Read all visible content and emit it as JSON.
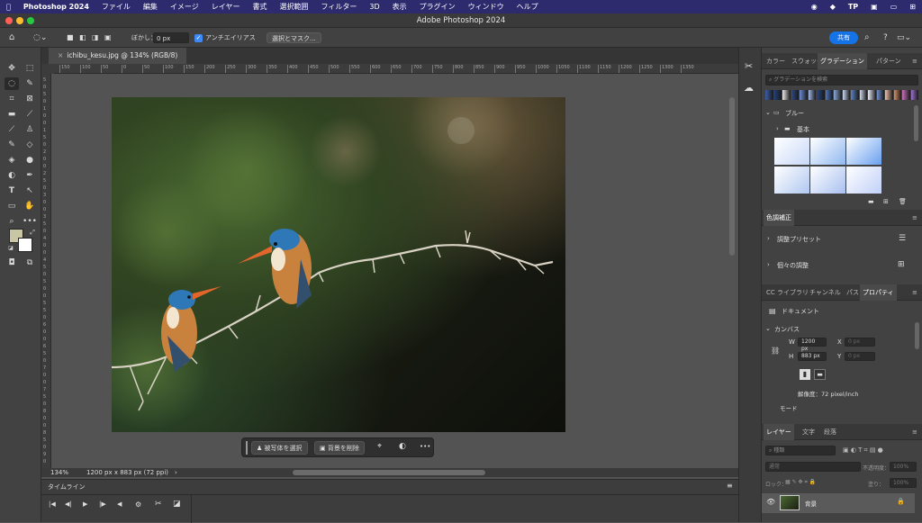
{
  "menubar": {
    "app": "Photoshop 2024",
    "items": [
      "ファイル",
      "編集",
      "イメージ",
      "レイヤー",
      "書式",
      "選択範囲",
      "フィルター",
      "3D",
      "表示",
      "プラグイン",
      "ウィンドウ",
      "ヘルプ"
    ],
    "tp": "TP"
  },
  "titlebar": {
    "title": "Adobe Photoshop 2024"
  },
  "options": {
    "feather_label": "ぼかし：",
    "feather_value": "0 px",
    "antialias_label": "アンチエイリアス",
    "select_mask": "選択とマスク...",
    "share": "共有"
  },
  "doc": {
    "tab_title": "ichibu_kesu.jpg @ 134% (RGB/8)"
  },
  "ruler": {
    "h_ticks": [
      "150",
      "100",
      "50",
      "0",
      "50",
      "100",
      "150",
      "200",
      "250",
      "300",
      "350",
      "400",
      "450",
      "500",
      "550",
      "600",
      "650",
      "700",
      "750",
      "800",
      "850",
      "900",
      "950",
      "1000",
      "1050",
      "1100",
      "1150",
      "1200",
      "1250",
      "1300",
      "1350"
    ],
    "v_ticks": [
      "5",
      "0",
      "5",
      "0",
      "1",
      "0",
      "0",
      "1",
      "5",
      "0",
      "2",
      "0",
      "0",
      "2",
      "5",
      "0",
      "3",
      "0",
      "0",
      "3",
      "5",
      "0",
      "4",
      "0",
      "0",
      "4",
      "5",
      "0",
      "5",
      "0",
      "0",
      "5",
      "5",
      "0",
      "6",
      "0",
      "0",
      "6",
      "5",
      "0",
      "7",
      "0",
      "0",
      "7",
      "5",
      "0",
      "8",
      "0",
      "0",
      "8",
      "5",
      "0",
      "9",
      "0"
    ]
  },
  "context_bar": {
    "select_subject": "被写体を選択",
    "remove_bg": "背景を削除",
    "more": "•••"
  },
  "status": {
    "zoom": "134%",
    "dims": "1200 px x 883 px (72 ppi)",
    "arrow": "›"
  },
  "timeline": {
    "title": "タイムライン"
  },
  "gradients": {
    "tabs": [
      "カラー",
      "スウォッチ",
      "グラデーション",
      "パターン"
    ],
    "search_placeholder": "グラデーションを検索",
    "folder_blue": "ブルー",
    "folder_basic": "基本",
    "swatch_colors": [
      "#3b5ea8",
      "#1f3f78",
      "#e8e8e8",
      "#2c4a8a",
      "#6a8ad0",
      "#a0b8e8",
      "#284680",
      "#4a78c8",
      "#8aa8d8",
      "#c8d8f0",
      "#5c84c4",
      "#d0d8ee",
      "#e8ecf8",
      "#7090d0",
      "#f0c0a8",
      "#d89060",
      "#c870b8",
      "#9a70d0"
    ],
    "grid_colors": [
      "#c8d8f8",
      "#90b8f0",
      "#6aa0f0",
      "#b0c8f0",
      "#a8c0f0",
      "#c0d0f8"
    ]
  },
  "adjust": {
    "tab": "色調補正",
    "preset": "調整プリセット",
    "individual": "個々の調整"
  },
  "props": {
    "tabs": [
      "CC ライブラリ",
      "チャンネル",
      "パス",
      "プロパティ"
    ],
    "doc_label": "ドキュメント",
    "canvas": "カンバス",
    "w_label": "W",
    "w_value": "1200 px",
    "h_label": "H",
    "h_value": "883 px",
    "x_label": "X",
    "y_label": "Y",
    "x_value": "0 px",
    "y_value": "0 px",
    "resolution": "解像度：72 pixel/inch",
    "mode": "モード"
  },
  "layers": {
    "tabs": [
      "レイヤー",
      "文字",
      "段落"
    ],
    "kind": "種類",
    "blend": "通常",
    "opacity_label": "不透明度：",
    "opacity": "100%",
    "lock_label": "ロック：",
    "fill_label": "塗り：",
    "fill": "100%",
    "layer_name": "背景"
  }
}
